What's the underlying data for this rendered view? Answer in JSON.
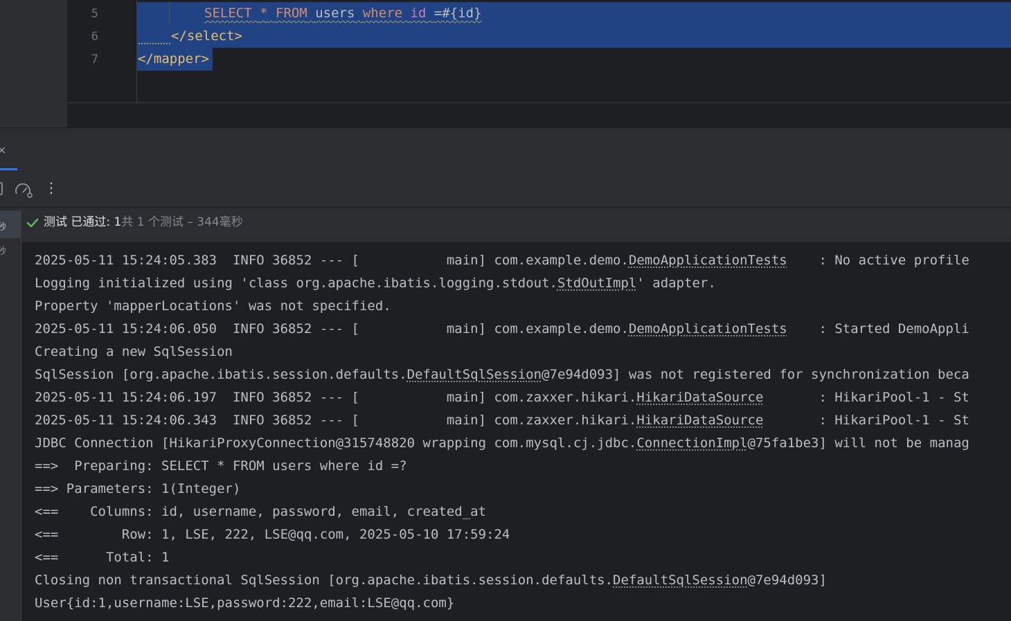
{
  "editor": {
    "line_numbers": [
      "5",
      "6",
      "7"
    ],
    "line5": {
      "kw_select": "SELECT",
      "star": "*",
      "kw_from": "FROM",
      "table": "users",
      "kw_where": "where",
      "field": "id",
      "rest": "=#{id}"
    },
    "line6": {
      "tag": "</select>"
    },
    "line7": {
      "tag": "</mapper>"
    }
  },
  "toolbar": {
    "close_glyph": "×",
    "more_glyph": "⋮"
  },
  "left_strip": {
    "glyph1": "秒",
    "glyph2": "秒"
  },
  "test_status": {
    "label": "测试 已通过: 1",
    "detail": "共 1 个测试 – 344毫秒"
  },
  "console": {
    "lines": [
      {
        "pre": "2025-05-11 15:24:05.383  INFO 36852 --- [           main] com.example.demo.",
        "ref": "DemoApplicationTests",
        "post": "    : No active profile"
      },
      {
        "pre": "Logging initialized using 'class org.apache.ibatis.logging.stdout.",
        "ref": "StdOutImpl",
        "post": "' adapter."
      },
      {
        "pre": "Property 'mapperLocations' was not specified.",
        "ref": "",
        "post": ""
      },
      {
        "pre": "2025-05-11 15:24:06.050  INFO 36852 --- [           main] com.example.demo.",
        "ref": "DemoApplicationTests",
        "post": "    : Started DemoAppli"
      },
      {
        "pre": "Creating a new SqlSession",
        "ref": "",
        "post": ""
      },
      {
        "pre": "SqlSession [org.apache.ibatis.session.defaults.",
        "ref": "DefaultSqlSession",
        "post": "@7e94d093] was not registered for synchronization beca"
      },
      {
        "pre": "2025-05-11 15:24:06.197  INFO 36852 --- [           main] com.zaxxer.hikari.",
        "ref": "HikariDataSource",
        "post": "       : HikariPool-1 - St"
      },
      {
        "pre": "2025-05-11 15:24:06.343  INFO 36852 --- [           main] com.zaxxer.hikari.",
        "ref": "HikariDataSource",
        "post": "       : HikariPool-1 - St"
      },
      {
        "pre": "JDBC Connection [HikariProxyConnection@315748820 wrapping com.mysql.cj.jdbc.",
        "ref": "ConnectionImpl",
        "post": "@75fa1be3] will not be manag"
      },
      {
        "pre": "==>  Preparing: SELECT * FROM users where id =?",
        "ref": "",
        "post": ""
      },
      {
        "pre": "==> Parameters: 1(Integer)",
        "ref": "",
        "post": ""
      },
      {
        "pre": "<==    Columns: id, username, password, email, created_at",
        "ref": "",
        "post": ""
      },
      {
        "pre": "<==        Row: 1, LSE, 222, LSE@qq.com, 2025-05-10 17:59:24",
        "ref": "",
        "post": ""
      },
      {
        "pre": "<==      Total: 1",
        "ref": "",
        "post": ""
      },
      {
        "pre": "Closing non transactional SqlSession [org.apache.ibatis.session.defaults.",
        "ref": "DefaultSqlSession",
        "post": "@7e94d093]"
      },
      {
        "pre": "User{id:1,username:LSE,password:222,email:LSE@qq.com}",
        "ref": "",
        "post": ""
      }
    ]
  },
  "colors": {
    "selection": "#214283",
    "keyword": "#cf8e6d",
    "tag": "#e8bf6a",
    "field": "#c77dbb",
    "success": "#5fb865",
    "accent": "#3574f0"
  }
}
